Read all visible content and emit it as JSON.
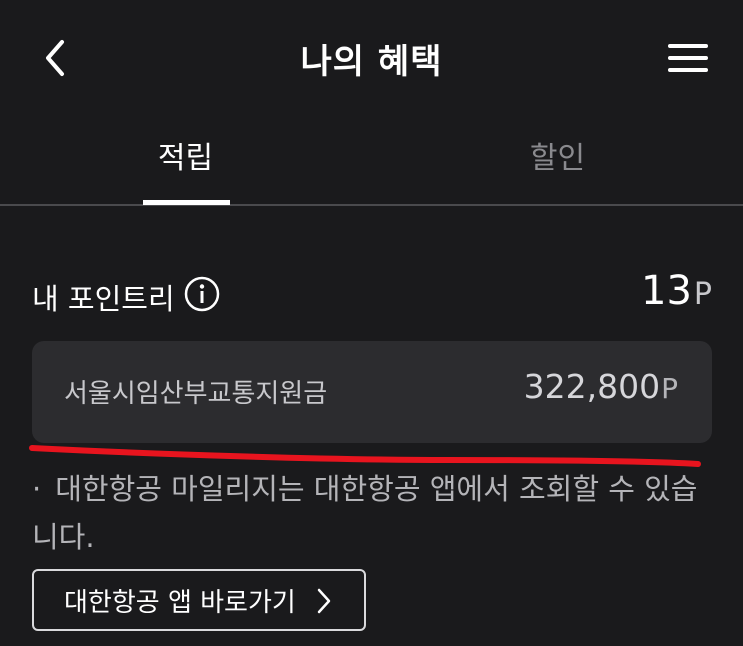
{
  "header": {
    "title": "나의 혜택",
    "back_icon": "chevron-left-icon",
    "menu_icon": "hamburger-menu-icon"
  },
  "tabs": [
    {
      "label": "적립",
      "active": true
    },
    {
      "label": "할인",
      "active": false
    }
  ],
  "points": {
    "label": "내 포인트리",
    "info_icon": "info-circle-icon",
    "value": "13",
    "unit": "P"
  },
  "subsidy": {
    "label": "서울시임산부교통지원금",
    "value": "322,800",
    "unit": "P"
  },
  "notice": {
    "bullet": "·",
    "text": "대한항공 마일리지는 대한항공 앱에서 조회할 수 있습니다."
  },
  "app_link": {
    "label": "대한항공 앱 바로가기",
    "icon": "chevron-right-icon"
  },
  "colors": {
    "background": "#1a1a1c",
    "card": "#2c2c2f",
    "annotation_red": "#e8141e",
    "inactive_tab": "#8a8a8e"
  }
}
